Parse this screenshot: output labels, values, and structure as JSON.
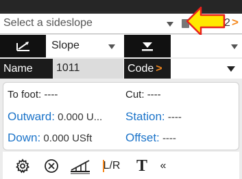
{
  "sideslope_select": {
    "placeholder": "Select a sideslope"
  },
  "nav": {
    "page_number": "2",
    "next_glyph": ">"
  },
  "slope_select": {
    "value": "Slope"
  },
  "name_field": {
    "label": "Name",
    "value": "1011"
  },
  "code_field": {
    "label": "Code",
    "arrow": ">"
  },
  "info": {
    "to_foot": {
      "label": "To foot:",
      "value": "----"
    },
    "cut": {
      "label": "Cut:",
      "value": "----"
    },
    "outward": {
      "label": "Outward:",
      "value": "0.000 U..."
    },
    "station": {
      "label": "Station:",
      "value": "----"
    },
    "down": {
      "label": "Down:",
      "value": "0.000 USft"
    },
    "offset": {
      "label": "Offset:",
      "value": "----"
    }
  },
  "toolbar": {
    "lr_label": "L/R",
    "text_label": "T",
    "more_label": "«",
    "icons": [
      "gear-icon",
      "circle-x-icon",
      "slope-measure-icon",
      "lr-icon",
      "text-icon",
      "collapse-icon"
    ]
  },
  "colors": {
    "accent_blue": "#1a73c9",
    "accent_orange": "#f5891e",
    "arrow_yellow": "#ffe800",
    "arrow_red": "#e8201c"
  }
}
